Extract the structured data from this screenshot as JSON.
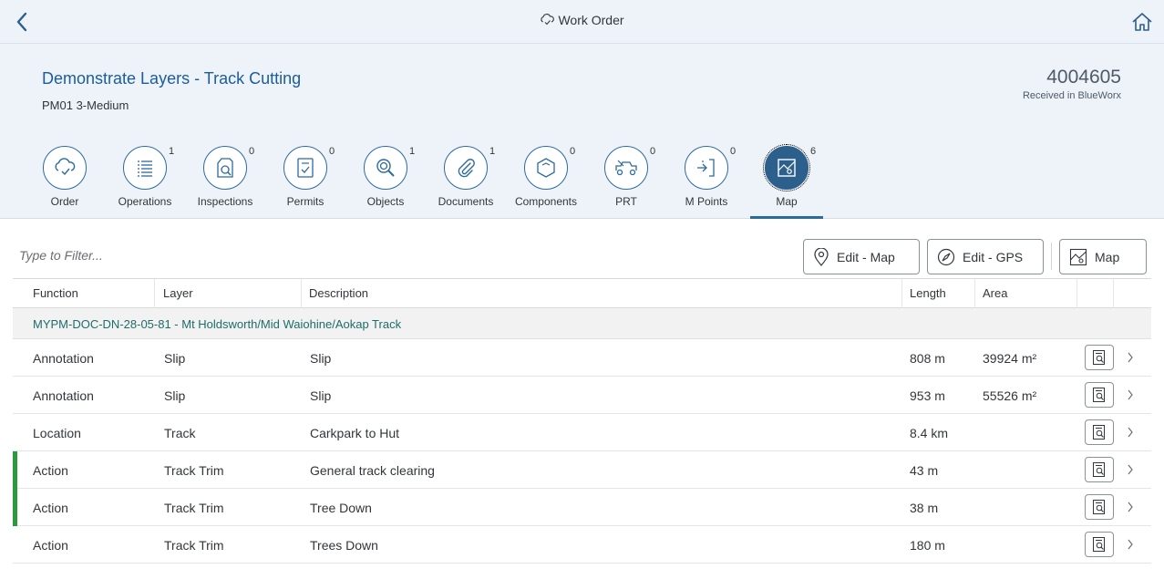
{
  "shell": {
    "title": "Work Order"
  },
  "header": {
    "title": "Demonstrate Layers - Track Cutting",
    "subtitle": "PM01 3-Medium",
    "number": "4004605",
    "number_status": "Received in BlueWorx"
  },
  "tabs": [
    {
      "label": "Order",
      "count": "",
      "icon": "order-cloud-check-icon"
    },
    {
      "label": "Operations",
      "count": "1",
      "icon": "list-icon"
    },
    {
      "label": "Inspections",
      "count": "0",
      "icon": "inspection-icon"
    },
    {
      "label": "Permits",
      "count": "0",
      "icon": "permit-icon"
    },
    {
      "label": "Objects",
      "count": "1",
      "icon": "objects-icon"
    },
    {
      "label": "Documents",
      "count": "1",
      "icon": "attachment-icon"
    },
    {
      "label": "Components",
      "count": "0",
      "icon": "component-icon"
    },
    {
      "label": "PRT",
      "count": "0",
      "icon": "tools-vehicle-icon"
    },
    {
      "label": "M Points",
      "count": "0",
      "icon": "measuring-point-icon"
    },
    {
      "label": "Map",
      "count": "6",
      "icon": "map-icon"
    }
  ],
  "toolbar": {
    "filter_placeholder": "Type to Filter...",
    "edit_map_label": "Edit - Map",
    "edit_gps_label": "Edit - GPS",
    "map_label": "Map"
  },
  "table": {
    "columns": [
      "Function",
      "Layer",
      "Description",
      "Length",
      "Area"
    ],
    "group_label": "MYPM-DOC-DN-28-05-81 - Mt Holdsworth/Mid Waiohine/Aokap Track",
    "rows": [
      {
        "function": "Annotation",
        "layer": "Slip",
        "description": "Slip",
        "length": "808 m",
        "area": "39924 m²",
        "highlight": false
      },
      {
        "function": "Annotation",
        "layer": "Slip",
        "description": "Slip",
        "length": "953 m",
        "area": "55526 m²",
        "highlight": false
      },
      {
        "function": "Location",
        "layer": "Track",
        "description": "Carkpark to Hut",
        "length": "8.4 km",
        "area": "",
        "highlight": false
      },
      {
        "function": "Action",
        "layer": "Track Trim",
        "description": "General track clearing",
        "length": "43 m",
        "area": "",
        "highlight": true
      },
      {
        "function": "Action",
        "layer": "Track Trim",
        "description": "Tree Down",
        "length": "38 m",
        "area": "",
        "highlight": true
      },
      {
        "function": "Action",
        "layer": "Track Trim",
        "description": "Trees Down",
        "length": "180 m",
        "area": "",
        "highlight": false
      }
    ]
  },
  "colors": {
    "accent": "#2c6a9e",
    "highlight_bar": "#2b9a3c",
    "group_text": "#1d6d6b"
  }
}
